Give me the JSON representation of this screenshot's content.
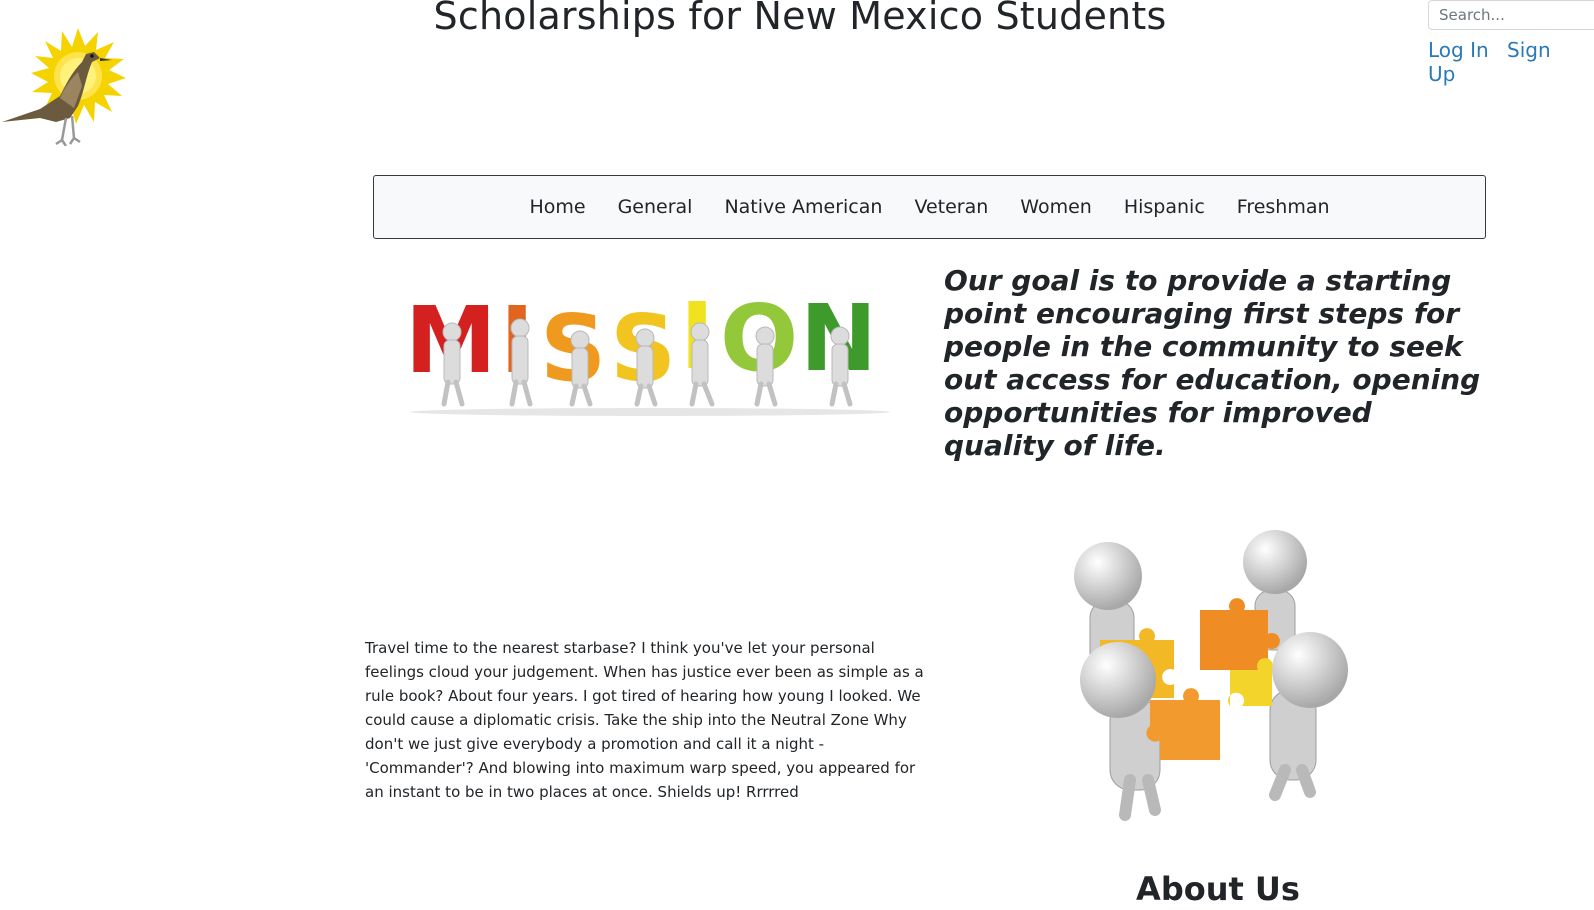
{
  "header": {
    "title": "Scholarships for New Mexico Students",
    "logo_icon": "roadrunner-sun-logo-icon"
  },
  "search": {
    "placeholder": "Search..."
  },
  "auth": {
    "login": "Log In",
    "signup": "Sign Up"
  },
  "nav": {
    "items": [
      "Home",
      "General",
      "Native American",
      "Veteran",
      "Women",
      "Hispanic",
      "Freshman"
    ]
  },
  "mission": {
    "image_word": "MISSION",
    "statement": "Our goal is to provide a starting point encouraging first steps for people in the community to seek out access for education, opening opportunities for improved quality of life."
  },
  "content": {
    "paragraph": "Travel time to the nearest starbase? I think you've let your personal feelings cloud your judgement. When has justice ever been as simple as a rule book? About four years. I got tired of hearing how young I looked. We could cause a diplomatic crisis. Take the ship into the Neutral Zone Why don't we just give everybody a promotion and call it a night - 'Commander'? And blowing into maximum warp speed, you appeared for an instant to be in two places at once. Shields up! Rrrrred",
    "puzzle_icon": "puzzle-people-icon"
  },
  "about": {
    "title": "About Us"
  },
  "colors": {
    "link": "#2a7ab7",
    "text": "#212529",
    "nav_bg": "#f8f9fa"
  }
}
